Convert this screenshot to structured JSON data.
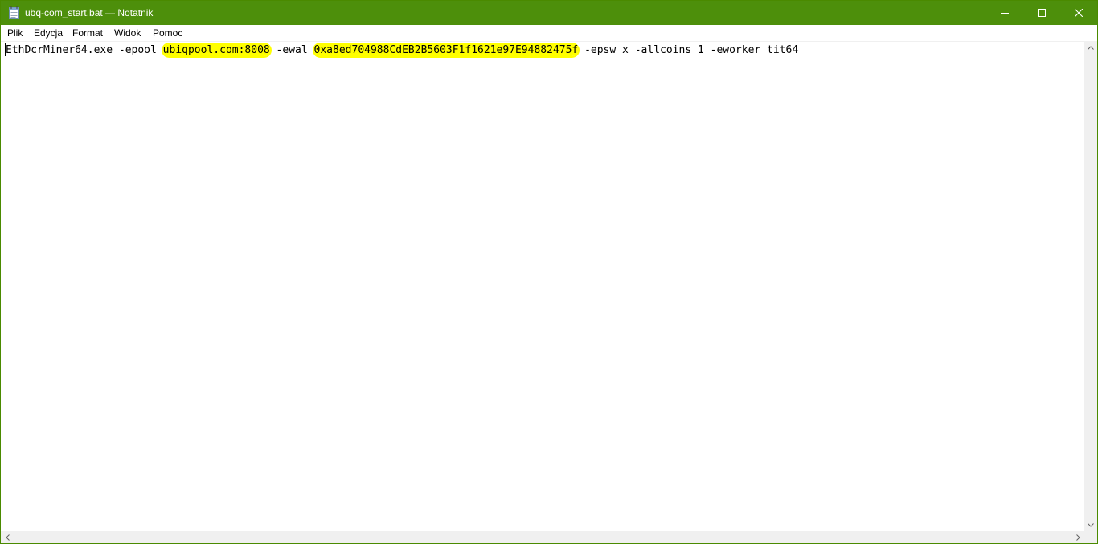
{
  "window": {
    "title": "ubq-com_start.bat — Notatnik",
    "accent_color": "#4d8f0b",
    "app_icon": "notepad-icon"
  },
  "controls": {
    "minimize_icon": "minimize-icon",
    "maximize_icon": "maximize-icon",
    "close_icon": "close-icon"
  },
  "menu": {
    "items": [
      {
        "label": "Plik"
      },
      {
        "label": "Edycja"
      },
      {
        "label": "Format"
      },
      {
        "label": "Widok"
      },
      {
        "label": "Pomoc"
      }
    ]
  },
  "editor": {
    "segments": [
      {
        "text": "EthDcrMiner64.exe -epool ",
        "highlight": false
      },
      {
        "text": "ubiqpool.com:8008",
        "highlight": true
      },
      {
        "text": " -ewal ",
        "highlight": false
      },
      {
        "text": "0xa8ed704988CdEB2B5603F1f1621e97E94882475f",
        "highlight": true
      },
      {
        "text": " -epsw x -allcoins 1 -eworker tit64",
        "highlight": false
      }
    ],
    "highlight_color": "#ffff00"
  }
}
